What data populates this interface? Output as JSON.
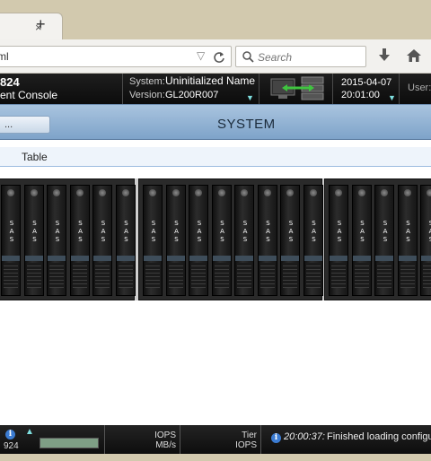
{
  "browser": {
    "tab_title": "...",
    "tab_close": "×",
    "new_tab": "+",
    "url": "ml",
    "search_placeholder": "Search"
  },
  "header": {
    "model": "824",
    "console": "ent Console",
    "system_label": "System:",
    "system_value": "Uninitialized Name",
    "version_label": "Version:",
    "version_value": "GL200R007",
    "date": "2015-04-07",
    "time": "20:01:00",
    "user_label": "User:"
  },
  "title_bar": {
    "button_label": "...",
    "title": "SYSTEM"
  },
  "subbar": {
    "tab_label": "Table"
  },
  "enclosures": [
    {
      "bay_label": "SAS",
      "bay_count": 6
    },
    {
      "bay_label": "SAS",
      "bay_count": 8
    },
    {
      "bay_label": "SAS",
      "bay_count": 5
    }
  ],
  "footer": {
    "info_glyph": "i",
    "count": "924",
    "iops_label": "IOPS",
    "mbs_label": "MB/s",
    "tier_label": "Tier",
    "tier_iops_label": "IOPS",
    "message_time": "20:00:37:",
    "message": "Finished loading configura"
  },
  "colors": {
    "header_bg": "#0c0c0c",
    "title_band": "#7ea3c9",
    "info_blue": "#3b7bd1",
    "accent_cyan": "#7fe0e0"
  }
}
